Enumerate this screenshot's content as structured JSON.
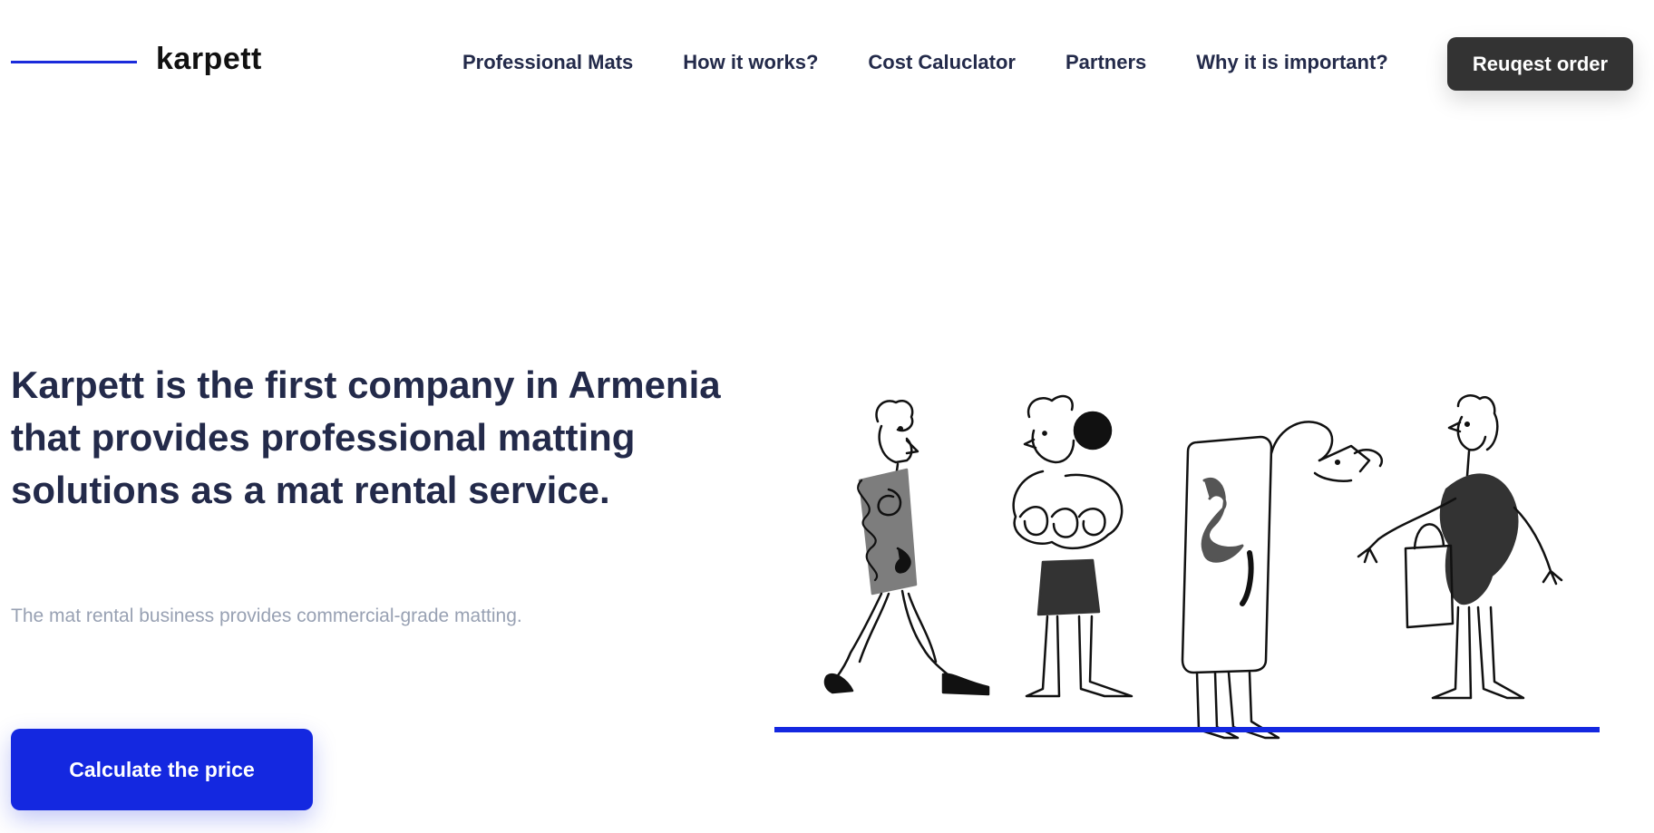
{
  "brand": {
    "name": "karpett",
    "accent": "#1a2bdb"
  },
  "nav": {
    "items": [
      {
        "label": "Professional Mats"
      },
      {
        "label": "How it works?"
      },
      {
        "label": "Cost Caluclator"
      },
      {
        "label": "Partners"
      },
      {
        "label": "Why it is important?"
      }
    ],
    "cta_label": "Reuqest order"
  },
  "hero": {
    "title": "Karpett is the first company in Armenia that provides professional matting solutions as a mat rental service.",
    "subtitle": "The mat rental business provides commercial-grade matting.",
    "cta_label": "Calculate the price",
    "cta_color": "#1428e0"
  },
  "illustration": {
    "name": "people-walking-on-mat-illustration"
  }
}
